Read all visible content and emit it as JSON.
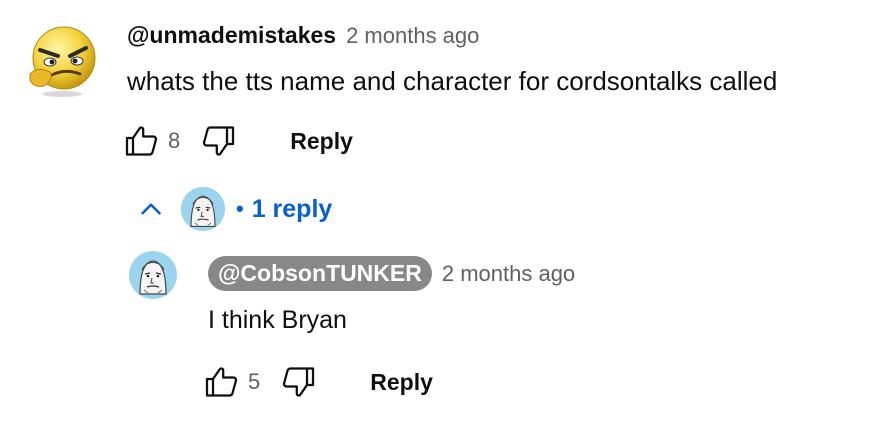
{
  "comment": {
    "author": "@unmademistakes",
    "timestamp": "2 months ago",
    "text": "whats the tts name and character for cordsontalks called",
    "like_count": "8",
    "reply_label": "Reply"
  },
  "replies_toggle": {
    "label": "1 reply"
  },
  "reply": {
    "author": "@CobsonTUNKER",
    "timestamp": "2 months ago",
    "text": "I think Bryan",
    "like_count": "5",
    "reply_label": "Reply"
  },
  "colors": {
    "link": "#065fd4",
    "muted": "#606060",
    "pill": "#888888"
  }
}
